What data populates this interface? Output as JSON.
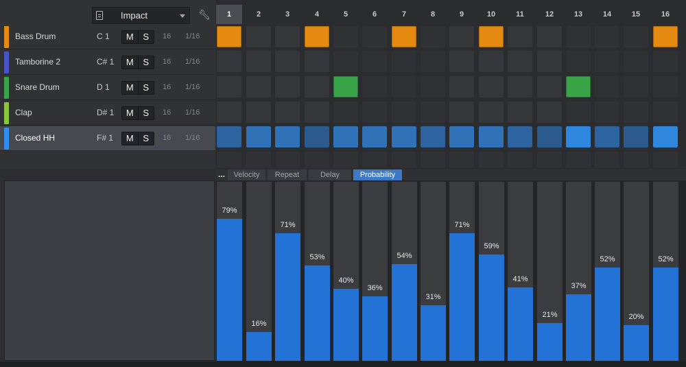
{
  "toolbar": {
    "instrument_name": "Impact",
    "document_icon": "document-icon",
    "wrench_icon": "wrench-icon"
  },
  "steps": [
    "1",
    "2",
    "3",
    "4",
    "5",
    "6",
    "7",
    "8",
    "9",
    "10",
    "11",
    "12",
    "13",
    "14",
    "15",
    "16"
  ],
  "current_step": 1,
  "tracks": [
    {
      "name": "Bass Drum",
      "note": "C 1",
      "mute": "M",
      "solo": "S",
      "steps": "16",
      "rate": "1/16",
      "color": "#e58a10",
      "selected": false,
      "pattern": [
        1,
        0,
        0,
        1,
        0,
        0,
        1,
        0,
        0,
        1,
        0,
        0,
        0,
        0,
        0,
        1
      ]
    },
    {
      "name": "Tamborine 2",
      "note": "C# 1",
      "mute": "M",
      "solo": "S",
      "steps": "16",
      "rate": "1/16",
      "color": "#4753c6",
      "selected": false,
      "pattern": [
        0,
        0,
        0,
        0,
        0,
        0,
        0,
        0,
        0,
        0,
        0,
        0,
        0,
        0,
        0,
        0
      ]
    },
    {
      "name": "Snare Drum",
      "note": "D 1",
      "mute": "M",
      "solo": "S",
      "steps": "16",
      "rate": "1/16",
      "color": "#38a347",
      "selected": false,
      "pattern": [
        0,
        0,
        0,
        0,
        1,
        0,
        0,
        0,
        0,
        0,
        0,
        0,
        1,
        0,
        0,
        0
      ]
    },
    {
      "name": "Clap",
      "note": "D# 1",
      "mute": "M",
      "solo": "S",
      "steps": "16",
      "rate": "1/16",
      "color": "#8ac53d",
      "selected": false,
      "pattern": [
        0,
        0,
        0,
        0,
        0,
        0,
        0,
        0,
        0,
        0,
        0,
        0,
        0,
        0,
        0,
        0
      ]
    },
    {
      "name": "Closed HH",
      "note": "F# 1",
      "mute": "M",
      "solo": "S",
      "steps": "16",
      "rate": "1/16",
      "color": "#2f8ef0",
      "selected": true,
      "pattern": [
        1,
        1,
        1,
        1,
        1,
        1,
        1,
        1,
        1,
        1,
        1,
        1,
        1,
        1,
        1,
        1
      ]
    }
  ],
  "editor": {
    "more_label": "...",
    "tabs": [
      "Velocity",
      "Repeat",
      "Delay",
      "Probability"
    ],
    "active_tab": "Probability",
    "probability": [
      79,
      16,
      71,
      53,
      40,
      36,
      54,
      31,
      71,
      59,
      41,
      21,
      37,
      52,
      20,
      52
    ],
    "labels": [
      "79%",
      "16%",
      "71%",
      "53%",
      "40%",
      "36%",
      "54%",
      "31%",
      "71%",
      "59%",
      "41%",
      "21%",
      "37%",
      "52%",
      "20%",
      "52%"
    ]
  },
  "colors": {
    "bar": "#2373d6",
    "hh_step_palette": [
      "#2c639f",
      "#2f72b8",
      "#2b5a8f",
      "#2f86dd"
    ],
    "hh_steps_shade": [
      0,
      1,
      1,
      2,
      1,
      1,
      1,
      0,
      1,
      1,
      0,
      2,
      3,
      0,
      2,
      3
    ],
    "tab_active": "#3c7ac8"
  }
}
